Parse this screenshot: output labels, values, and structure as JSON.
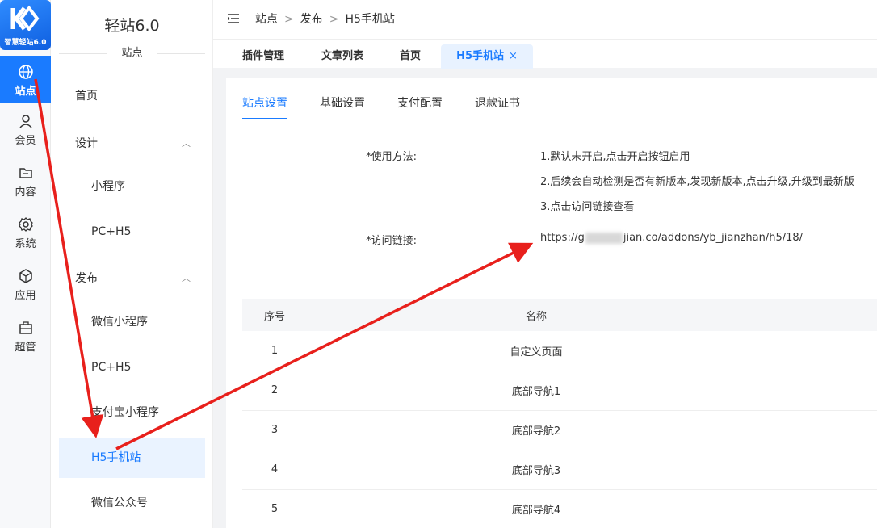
{
  "rail": {
    "brand": "智慧轻站6.0",
    "items": [
      {
        "label": "站点",
        "icon": "globe-icon",
        "active": true
      },
      {
        "label": "会员",
        "icon": "user-icon"
      },
      {
        "label": "内容",
        "icon": "folder-icon"
      },
      {
        "label": "系统",
        "icon": "gear-icon"
      },
      {
        "label": "应用",
        "icon": "cube-icon"
      },
      {
        "label": "超管",
        "icon": "briefcase-icon"
      }
    ]
  },
  "submenu": {
    "title": "轻站6.0",
    "section": "站点",
    "items": [
      {
        "label": "首页"
      },
      {
        "label": "设计",
        "chevron": "^"
      },
      {
        "label": "小程序"
      },
      {
        "label": "PC+H5"
      },
      {
        "label": "发布",
        "chevron": "^"
      },
      {
        "label": "微信小程序"
      },
      {
        "label": "PC+H5"
      },
      {
        "label": "支付宝小程序"
      },
      {
        "label": "H5手机站",
        "active": true
      },
      {
        "label": "微信公众号"
      }
    ]
  },
  "header": {
    "crumbs": [
      "站点",
      "发布",
      "H5手机站"
    ],
    "crumb_sep": ">"
  },
  "tabs": [
    {
      "label": "插件管理"
    },
    {
      "label": "文章列表"
    },
    {
      "label": "首页"
    },
    {
      "label": "H5手机站",
      "active": true,
      "close": "×"
    }
  ],
  "content": {
    "tabs": [
      {
        "label": "站点设置",
        "active": true
      },
      {
        "label": "基础设置"
      },
      {
        "label": "支付配置"
      },
      {
        "label": "退款证书"
      }
    ],
    "usage_label": "*使用方法:",
    "usage_lines": [
      "1.默认未开启,点击开启按钮启用",
      "2.后续会自动检测是否有新版本,发现新版本,点击升级,升级到最新版",
      "3.点击访问链接查看"
    ],
    "link_label": "*访问链接:",
    "link_prefix": "https://g",
    "link_suffix": "jian.co/addons/yb_jianzhan/h5/18/"
  },
  "table": {
    "headers": [
      "序号",
      "名称"
    ],
    "rows": [
      [
        "1",
        "自定义页面"
      ],
      [
        "2",
        "底部导航1"
      ],
      [
        "3",
        "底部导航2"
      ],
      [
        "4",
        "底部导航3"
      ],
      [
        "5",
        "底部导航4"
      ]
    ]
  },
  "colors": {
    "accent": "#1a7bff",
    "arrow": "#e8201c"
  }
}
